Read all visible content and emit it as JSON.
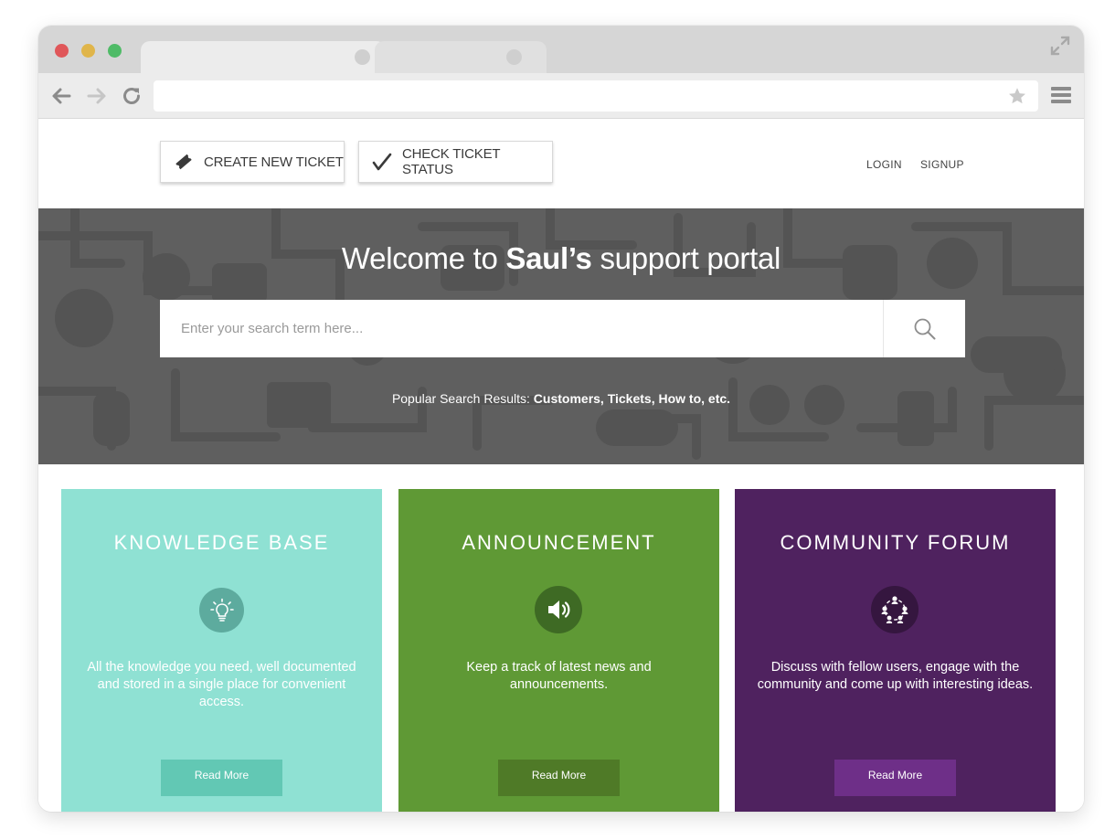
{
  "header": {
    "create_ticket_label": "CREATE NEW TICKET",
    "check_status_label": "CHECK TICKET STATUS",
    "login_label": "LOGIN",
    "signup_label": "SIGNUP"
  },
  "hero": {
    "title_prefix": "Welcome to ",
    "title_brand": "Saul’s",
    "title_suffix": " support portal",
    "search_placeholder": "Enter your search term here...",
    "popular_label": "Popular Search Results: ",
    "popular_terms": "Customers, Tickets, How to, etc."
  },
  "cards": [
    {
      "title": "KNOWLEDGE BASE",
      "icon": "lightbulb-icon",
      "description": "All the knowledge you need, well documented and stored in a single place for convenient access.",
      "button": "Read More",
      "color": "#8fe1d3"
    },
    {
      "title": "ANNOUNCEMENT",
      "icon": "speaker-icon",
      "description": "Keep a track of latest news and announcements.",
      "button": "Read More",
      "color": "#5f9935"
    },
    {
      "title": "COMMUNITY FORUM",
      "icon": "community-icon",
      "description": "Discuss with fellow users, engage with the community and come up with interesting ideas.",
      "button": "Read More",
      "color": "#4f225f"
    }
  ],
  "colors": {
    "hero_background": "#5f5f5f",
    "window_chrome": "#d6d6d6"
  }
}
